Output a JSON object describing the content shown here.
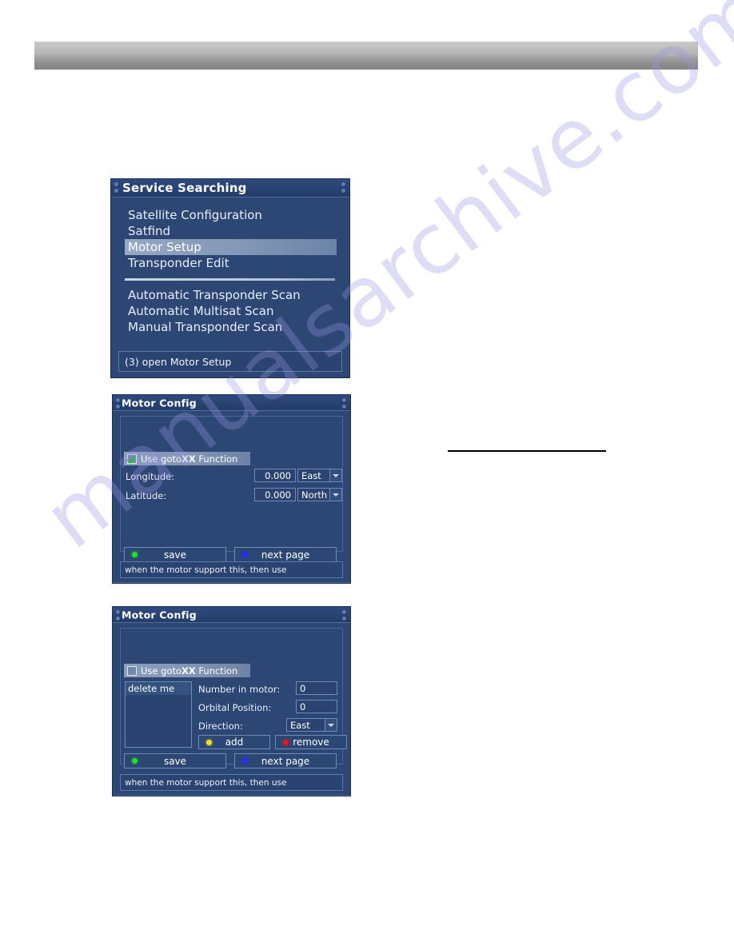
{
  "page": {
    "watermark": "manualsarchive.com",
    "watermark_color": "#9696e1"
  },
  "dialogs": {
    "service_searching": {
      "title": "Service Searching",
      "menu_group_1": [
        {
          "label": "Satellite Configuration",
          "selected": false
        },
        {
          "label": "Satfind",
          "selected": false
        },
        {
          "label": "Motor Setup",
          "selected": true
        },
        {
          "label": "Transponder Edit",
          "selected": false
        }
      ],
      "menu_group_2": [
        {
          "label": "Automatic Transponder Scan",
          "selected": false
        },
        {
          "label": "Automatic Multisat Scan",
          "selected": false
        },
        {
          "label": "Manual Transponder Scan",
          "selected": false
        }
      ],
      "status": "(3) open Motor Setup"
    },
    "motor_config_page1": {
      "title": "Motor Config",
      "gotoxx": {
        "label_plain": "Use goto",
        "label_bold": "XX",
        "label_tail": " Function",
        "checked": true
      },
      "longitude": {
        "label": "Longitude:",
        "value": "0.000",
        "direction": "East"
      },
      "latitude": {
        "label": "Latitude:",
        "value": "0.000",
        "direction": "North"
      },
      "buttons": {
        "save": "save",
        "next_page": "next page"
      },
      "footer": "when the motor support this, then use"
    },
    "motor_config_page2": {
      "title": "Motor Config",
      "gotoxx": {
        "label_plain": "Use goto",
        "label_bold": "XX",
        "label_tail": " Function",
        "checked": false
      },
      "list_items": [
        "delete me"
      ],
      "number_in_motor": {
        "label": "Number in motor:",
        "value": "0"
      },
      "orbital_position": {
        "label": "Orbital Position:",
        "value": "0"
      },
      "direction": {
        "label": "Direction:",
        "value": "East"
      },
      "buttons": {
        "add": "add",
        "remove": "remove",
        "save": "save",
        "next_page": "next page"
      },
      "footer": "when the motor support this, then use"
    }
  }
}
